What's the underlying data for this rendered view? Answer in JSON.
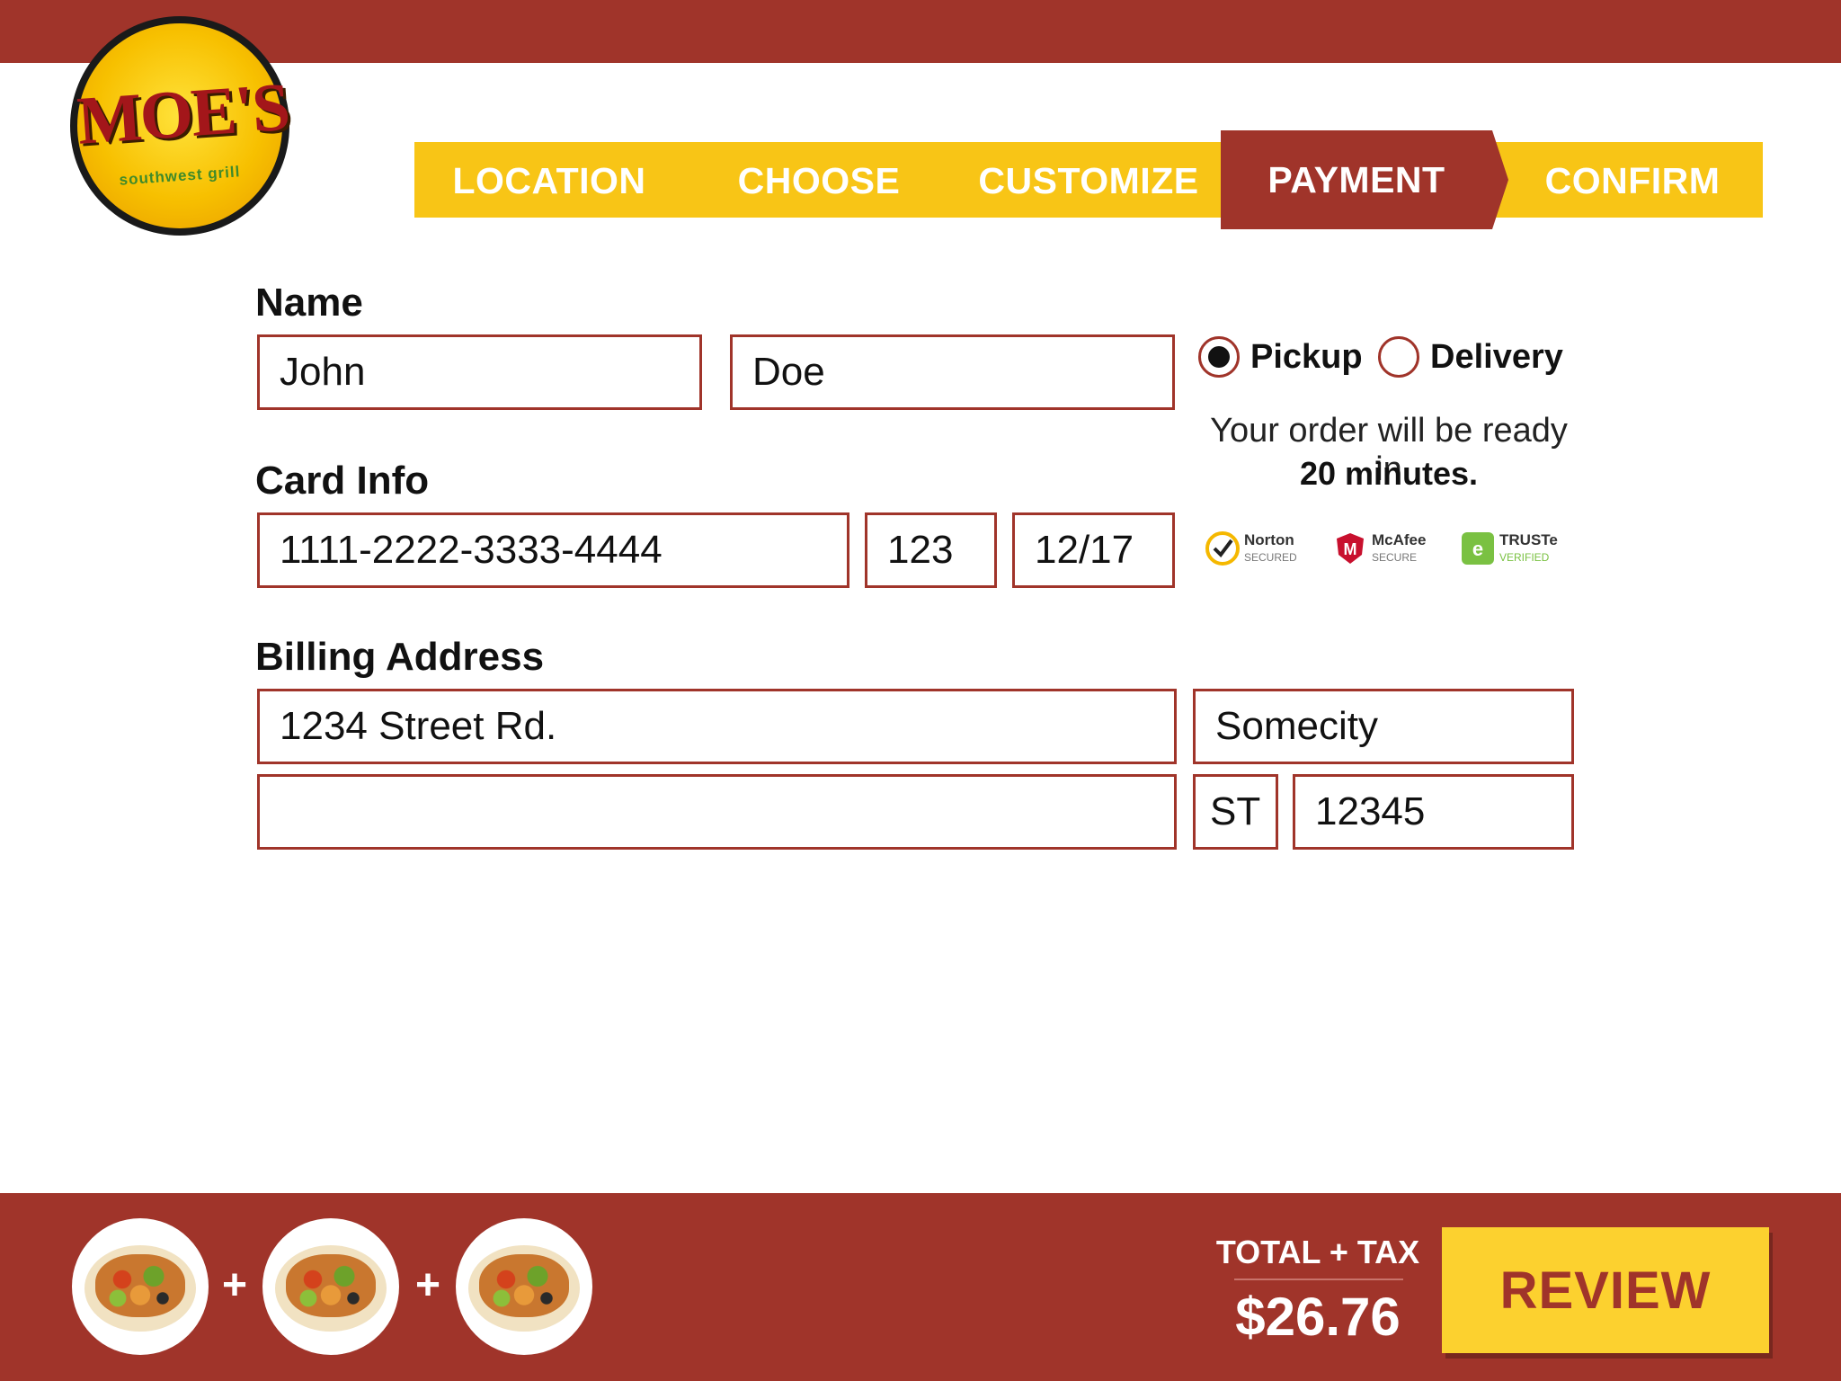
{
  "brand": {
    "logo_text": "MOE'S",
    "logo_subtext": "southwest grill",
    "colors": {
      "primary": "#a0342a",
      "accent": "#f8c516",
      "button": "#fcd12f"
    }
  },
  "steps": [
    {
      "label": "LOCATION",
      "active": false
    },
    {
      "label": "CHOOSE",
      "active": false
    },
    {
      "label": "CUSTOMIZE",
      "active": false
    },
    {
      "label": "PAYMENT",
      "active": true
    },
    {
      "label": "CONFIRM",
      "active": false
    }
  ],
  "form": {
    "name_label": "Name",
    "first_name": "John",
    "last_name": "Doe",
    "card_label": "Card Info",
    "card_number": "1111-2222-3333-4444",
    "cvv": "123",
    "expiry": "12/17",
    "billing_label": "Billing Address",
    "address1": "1234 Street Rd.",
    "city": "Somecity",
    "address2": "",
    "state": "ST",
    "zip": "12345"
  },
  "order_type": {
    "pickup_label": "Pickup",
    "delivery_label": "Delivery",
    "selected": "pickup",
    "ready_text": "Your order will be ready in",
    "ready_time": "20 minutes."
  },
  "security_badges": [
    {
      "name": "Norton",
      "sub": "SECURED",
      "icon": "norton-check-icon"
    },
    {
      "name": "McAfee",
      "sub": "SECURE",
      "icon": "mcafee-shield-icon"
    },
    {
      "name": "TRUSTe",
      "sub": "VERIFIED",
      "icon": "truste-icon"
    }
  ],
  "cart": {
    "items": [
      "burrito-image",
      "burrito-image",
      "burrito-image"
    ],
    "separator": "+"
  },
  "total": {
    "label": "TOTAL + TAX",
    "amount": "$26.76"
  },
  "review_button": "REVIEW"
}
